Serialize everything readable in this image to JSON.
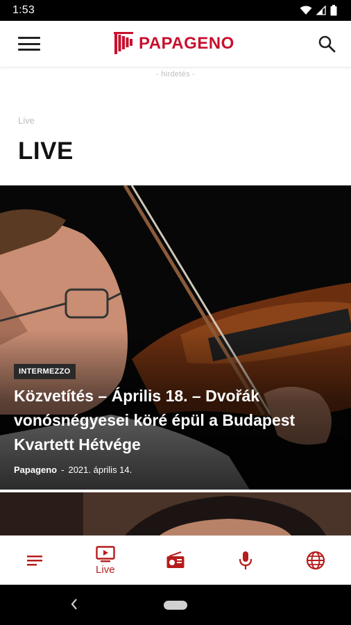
{
  "status_bar": {
    "time": "1:53"
  },
  "app_bar": {
    "logo_text": "PAPAGENO"
  },
  "ad": {
    "label": "- hirdetés -"
  },
  "breadcrumb": "Live",
  "page_title": "LIVE",
  "hero_article": {
    "category": "INTERMEZZO",
    "title": "Közvetítés – Április 18. – Dvořák vonósnégyesei köré épül a Budapest Kvartett Hétvége",
    "author": "Papageno",
    "separator": "-",
    "date": "2021. április 14."
  },
  "bottom_nav": {
    "items": [
      {
        "icon": "menu-lines-icon",
        "label": ""
      },
      {
        "icon": "live-tv-icon",
        "label": "Live"
      },
      {
        "icon": "radio-icon",
        "label": ""
      },
      {
        "icon": "microphone-icon",
        "label": ""
      },
      {
        "icon": "globe-icon",
        "label": ""
      }
    ],
    "active_color": "#b71c1c"
  },
  "colors": {
    "brand": "#c8102e",
    "accent": "#b71c1c"
  }
}
